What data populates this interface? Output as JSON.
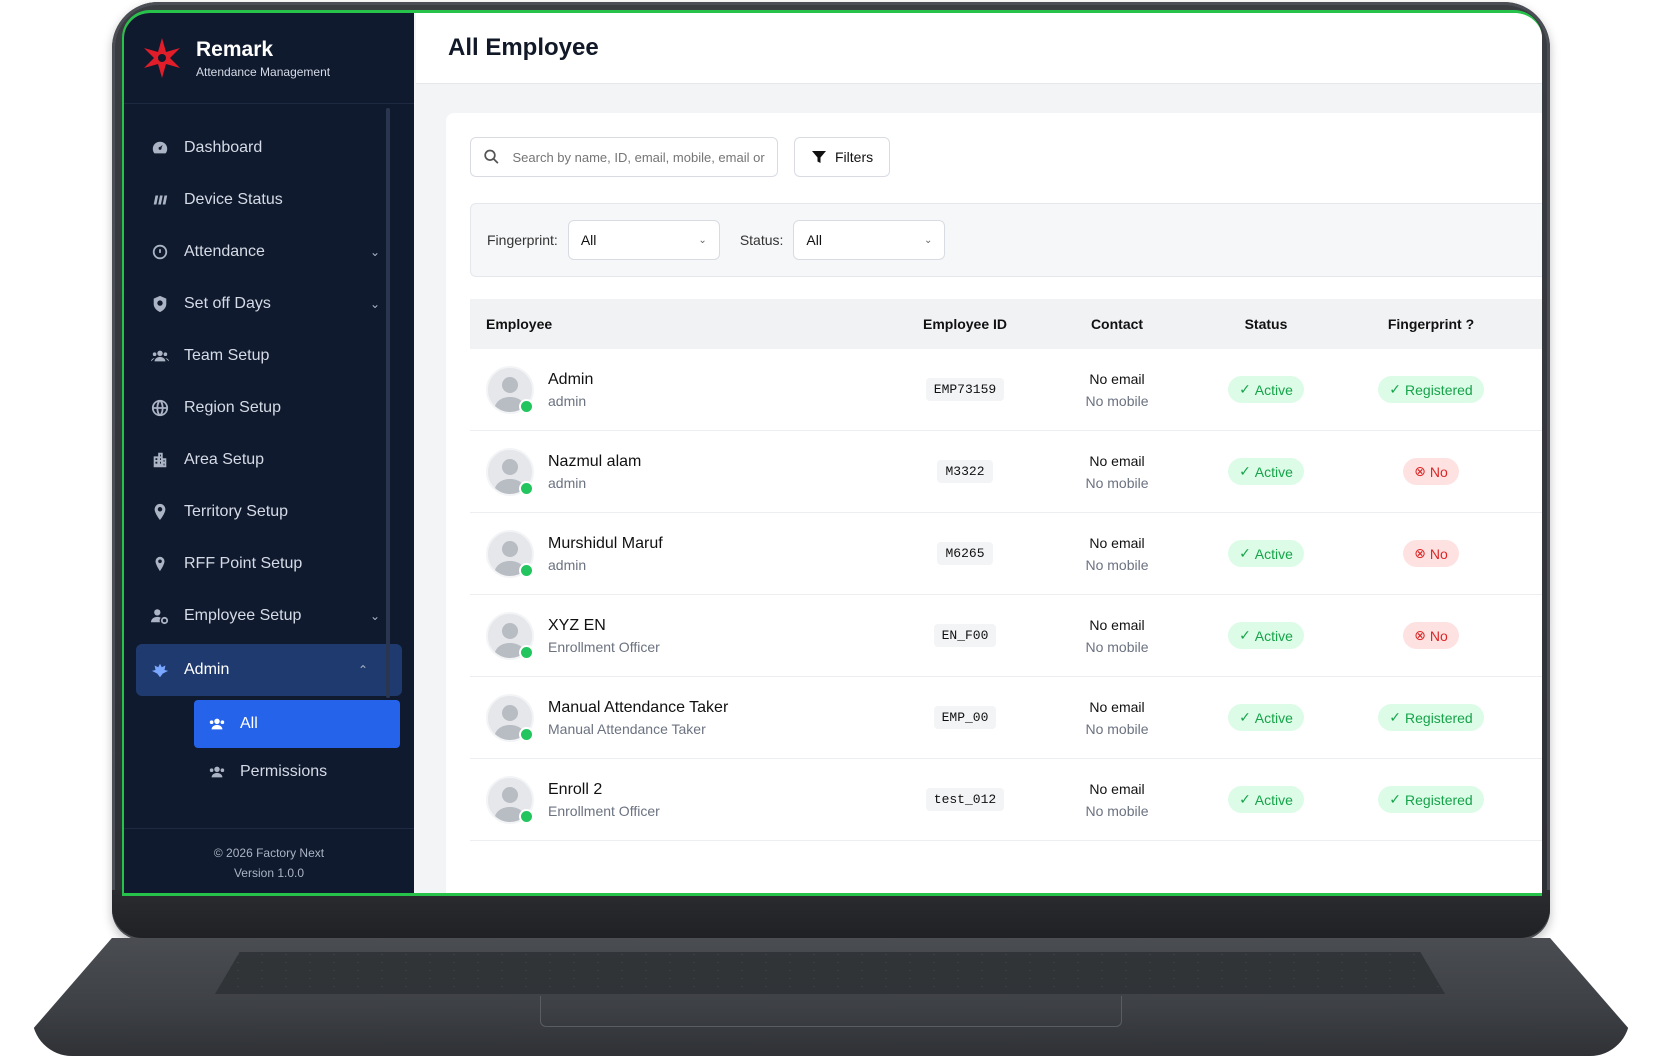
{
  "brand": {
    "name": "Remark",
    "subtitle": "Attendance Management"
  },
  "sidebar": {
    "items": [
      {
        "label": "Dashboard",
        "icon": "dashboard-icon"
      },
      {
        "label": "Device Status",
        "icon": "device-icon"
      },
      {
        "label": "Attendance",
        "icon": "clock-icon",
        "expandable": true
      },
      {
        "label": "Set off Days",
        "icon": "shield-icon",
        "expandable": true
      },
      {
        "label": "Team Setup",
        "icon": "team-icon"
      },
      {
        "label": "Region Setup",
        "icon": "globe-icon"
      },
      {
        "label": "Area Setup",
        "icon": "building-icon"
      },
      {
        "label": "Territory Setup",
        "icon": "map-pin-icon"
      },
      {
        "label": "RFF Point Setup",
        "icon": "location-icon"
      },
      {
        "label": "Employee Setup",
        "icon": "user-cog-icon",
        "expandable": true
      },
      {
        "label": "Admin",
        "icon": "admin-icon",
        "expanded": true
      }
    ],
    "sub_items": [
      {
        "label": "All",
        "icon": "users-icon",
        "active": true
      },
      {
        "label": "Permissions",
        "icon": "users-icon"
      }
    ],
    "footer": {
      "copyright": "© 2026 Factory Next",
      "version": "Version 1.0.0"
    }
  },
  "page": {
    "title": "All Employee"
  },
  "search": {
    "placeholder": "Search by name, ID, email, mobile, email or"
  },
  "filters_button": {
    "label": "Filters"
  },
  "filter_panel": {
    "fingerprint_label": "Fingerprint:",
    "fingerprint_value": "All",
    "status_label": "Status:",
    "status_value": "All"
  },
  "table": {
    "headers": [
      "Employee",
      "Employee ID",
      "Contact",
      "Status",
      "Fingerprint ?"
    ],
    "rows": [
      {
        "name": "Admin",
        "role": "admin",
        "id": "EMP73159",
        "email": "No email",
        "mobile": "No mobile",
        "status": "Active",
        "fingerprint": "Registered"
      },
      {
        "name": "Nazmul alam",
        "role": "admin",
        "id": "M3322",
        "email": "No email",
        "mobile": "No mobile",
        "status": "Active",
        "fingerprint": "No"
      },
      {
        "name": "Murshidul Maruf",
        "role": "admin",
        "id": "M6265",
        "email": "No email",
        "mobile": "No mobile",
        "status": "Active",
        "fingerprint": "No"
      },
      {
        "name": "XYZ EN",
        "role": "Enrollment Officer",
        "id": "EN_F00",
        "email": "No email",
        "mobile": "No mobile",
        "status": "Active",
        "fingerprint": "No"
      },
      {
        "name": "Manual Attendance Taker",
        "role": "Manual Attendance Taker",
        "id": "EMP_00",
        "email": "No email",
        "mobile": "No mobile",
        "status": "Active",
        "fingerprint": "Registered"
      },
      {
        "name": "Enroll 2",
        "role": "Enrollment Officer",
        "id": "test_012",
        "email": "No email",
        "mobile": "No mobile",
        "status": "Active",
        "fingerprint": "Registered"
      }
    ]
  },
  "colors": {
    "sidebar_bg": "#0f1a2e",
    "active_blue": "#2563eb",
    "success_green": "#16a34a",
    "danger_red": "#dc2626",
    "brand_red": "#e11d2a"
  }
}
